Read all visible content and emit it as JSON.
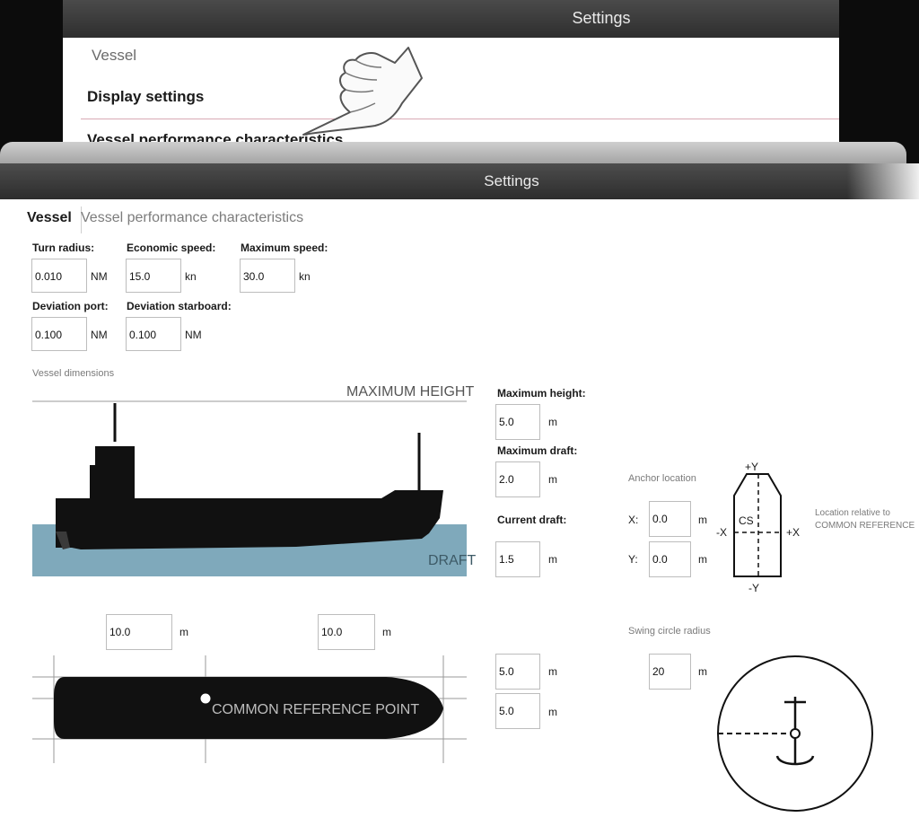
{
  "background_screen": {
    "title": "Settings",
    "menu_items": [
      "Vessel",
      "Display settings",
      "Vessel performance characteristics"
    ]
  },
  "settings": {
    "title": "Settings",
    "tabs": [
      "Vessel",
      "Vessel performance characteristics"
    ],
    "turn_radius": {
      "label": "Turn radius:",
      "value": "0.010",
      "unit": "NM"
    },
    "economic_speed": {
      "label": "Economic speed:",
      "value": "15.0",
      "unit": "kn"
    },
    "maximum_speed": {
      "label": "Maximum speed:",
      "value": "30.0",
      "unit": "kn"
    },
    "deviation_port": {
      "label": "Deviation port:",
      "value": "0.100",
      "unit": "NM"
    },
    "deviation_starboard": {
      "label": "Deviation starboard:",
      "value": "0.100",
      "unit": "NM"
    },
    "vessel_dimensions_label": "Vessel dimensions",
    "diagram_labels": {
      "maximum_height": "MAXIMUM HEIGHT",
      "draft": "DRAFT",
      "common_reference_point": "COMMON REFERENCE POINT"
    },
    "maximum_height": {
      "label": "Maximum height:",
      "value": "5.0",
      "unit": "m"
    },
    "maximum_draft": {
      "label": "Maximum draft:",
      "value": "2.0",
      "unit": "m"
    },
    "current_draft": {
      "label": "Current draft:",
      "value": "1.5",
      "unit": "m"
    },
    "anchor_location": {
      "label": "Anchor location",
      "x_label": "X:",
      "x_value": "0.0",
      "y_label": "Y:",
      "y_value": "0.0",
      "unit": "m",
      "axis": {
        "plus_y": "+Y",
        "minus_y": "-Y",
        "plus_x": "+X",
        "minus_x": "-X",
        "center": "CS"
      },
      "note": "Location relative to COMMON REFERENCE POINT"
    },
    "length_aft": {
      "value": "10.0",
      "unit": "m"
    },
    "length_fwd": {
      "value": "10.0",
      "unit": "m"
    },
    "beam_port": {
      "value": "5.0",
      "unit": "m"
    },
    "beam_starboard": {
      "value": "5.0",
      "unit": "m"
    },
    "swing_circle": {
      "label": "Swing circle radius",
      "value": "20",
      "unit": "m"
    }
  },
  "colors": {
    "title_bar": "#3a3a3a",
    "water": "#7fa9bb",
    "hull": "#111111"
  }
}
